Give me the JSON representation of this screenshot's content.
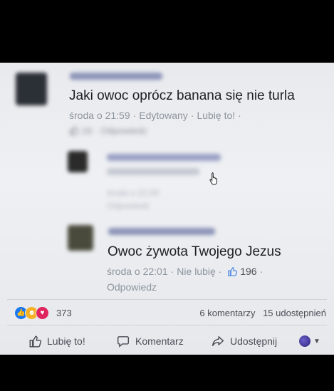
{
  "post": {
    "comments": [
      {
        "text": "Jaki owoc oprócz banana się nie turla",
        "day_time": "środa o 21:59",
        "edited": "Edytowany",
        "like_action": "Lubię to!",
        "likes": "16",
        "reply": "Odpowiedz"
      },
      {
        "day_time": "środa o 22:00",
        "reply": "Odpowiedz"
      },
      {
        "text": "Owoc żywota Twojego Jezus",
        "day_time": "środa o 22:01",
        "like_action": "Nie lubię",
        "likes": "196",
        "reply": "Odpowiedz"
      }
    ],
    "reactions": {
      "count": "373",
      "icons": [
        "like-icon",
        "haha-icon",
        "love-icon"
      ]
    },
    "stats": {
      "comments": "6 komentarzy",
      "shares": "15 udostępnień"
    },
    "actions": {
      "like": "Lubię to!",
      "comment": "Komentarz",
      "share": "Udostępnij"
    },
    "colors": {
      "like_blue": "#1877f2",
      "haha_yellow": "#f7b125",
      "love_red": "#e0245e",
      "meta_gray": "#8d949e"
    }
  }
}
